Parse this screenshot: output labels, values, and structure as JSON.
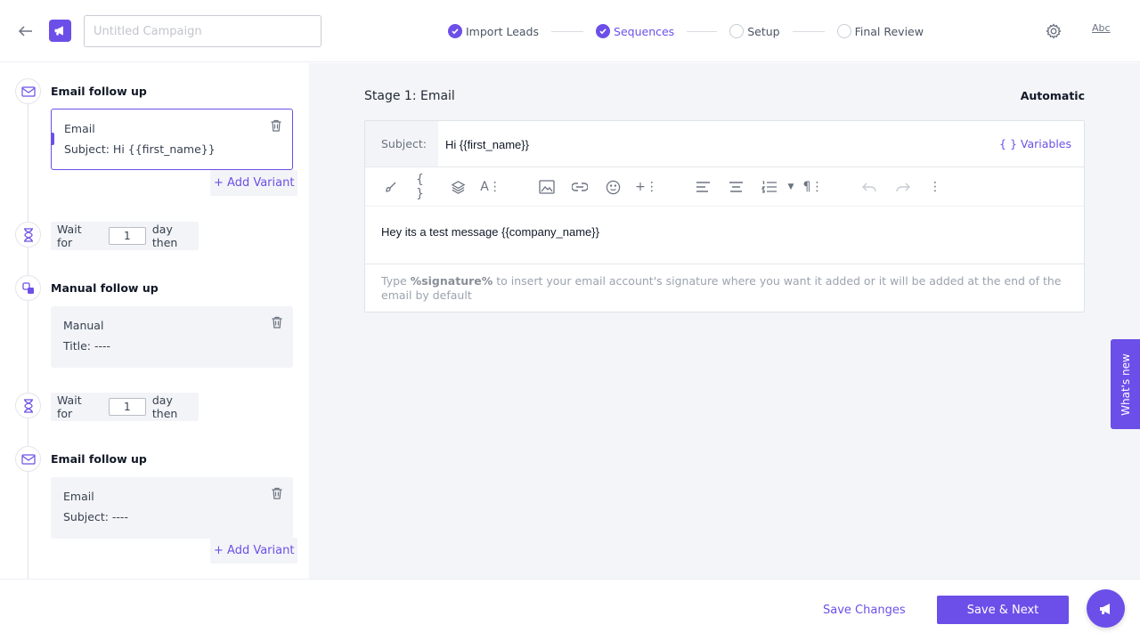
{
  "header": {
    "campaign_placeholder": "Untitled Campaign",
    "steps": [
      {
        "label": "Import Leads",
        "state": "done"
      },
      {
        "label": "Sequences",
        "state": "active"
      },
      {
        "label": "Setup",
        "state": "todo"
      },
      {
        "label": "Final Review",
        "state": "todo"
      }
    ],
    "abc_label": "Abc"
  },
  "sidebar": {
    "blocks": [
      {
        "title": "Email follow up",
        "card_line1": "Email",
        "card_line2": "Subject: Hi {{first_name}}",
        "add_variant": "+ Add Variant"
      },
      {
        "wait_prefix": "Wait for",
        "wait_value": "1",
        "wait_suffix": "day then"
      },
      {
        "title": "Manual follow up",
        "card_line1": "Manual",
        "card_line2": "Title: ----"
      },
      {
        "wait_prefix": "Wait for",
        "wait_value": "1",
        "wait_suffix": "day then"
      },
      {
        "title": "Email follow up",
        "card_line1": "Email",
        "card_line2": "Subject: ----",
        "add_variant": "+ Add Variant"
      }
    ]
  },
  "main": {
    "stage_title": "Stage 1: Email",
    "mode": "Automatic",
    "subject_label": "Subject:",
    "subject_value": "Hi {{first_name}}",
    "variables_label": "{ } Variables",
    "body": "Hey its a test message {{company_name}}",
    "signature_hint_pre": "Type ",
    "signature_hint_token": "%signature%",
    "signature_hint_post": " to insert your email account's signature where you want it added or it will be added at the end of the email by default",
    "whats_new": "What's new"
  },
  "footer": {
    "save_changes": "Save Changes",
    "save_next": "Save & Next"
  },
  "colors": {
    "accent": "#6c4fe8"
  }
}
